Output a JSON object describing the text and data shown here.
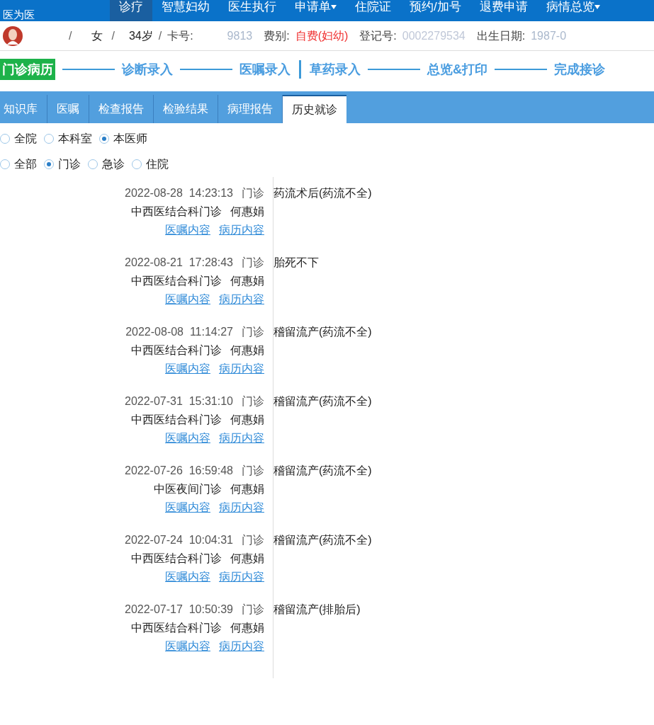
{
  "top_nav": {
    "logo_text": "医为医",
    "items": [
      {
        "label": "诊疗",
        "selected": true,
        "dropdown": false
      },
      {
        "label": "智慧妇幼",
        "selected": false,
        "dropdown": false
      },
      {
        "label": "医生执行",
        "selected": false,
        "dropdown": false
      },
      {
        "label": "申请单",
        "selected": false,
        "dropdown": true
      },
      {
        "label": "住院证",
        "selected": false,
        "dropdown": false
      },
      {
        "label": "预约/加号",
        "selected": false,
        "dropdown": false
      },
      {
        "label": "退费申请",
        "selected": false,
        "dropdown": false
      },
      {
        "label": "病情总览",
        "selected": false,
        "dropdown": true
      }
    ]
  },
  "patient": {
    "slash_1": "/",
    "sex": "女",
    "slash_2": "/",
    "age": "34岁",
    "slash_3": "/",
    "card_label": "卡号:",
    "card_value": "9813",
    "fee_label": "费别:",
    "fee_value": "自费(妇幼)",
    "reg_label": "登记号:",
    "reg_value": "0002279534",
    "birth_label": "出生日期:",
    "birth_value": "1987-0"
  },
  "workflow": {
    "badge": "门诊病历",
    "steps": [
      {
        "label": "诊断录入",
        "kind": "line"
      },
      {
        "label": "医嘱录入",
        "kind": "line"
      },
      {
        "label": "草药录入",
        "kind": "bar"
      },
      {
        "label": "总览&打印",
        "kind": "line"
      },
      {
        "label": "完成接诊",
        "kind": "line"
      }
    ]
  },
  "tabs": [
    {
      "label": "知识库",
      "selected": false
    },
    {
      "label": "医嘱",
      "selected": false
    },
    {
      "label": "检查报告",
      "selected": false
    },
    {
      "label": "检验结果",
      "selected": false
    },
    {
      "label": "病理报告",
      "selected": false
    },
    {
      "label": "历史就诊",
      "selected": true
    }
  ],
  "scope_filter": [
    {
      "label": "全院",
      "selected": false
    },
    {
      "label": "本科室",
      "selected": false
    },
    {
      "label": "本医师",
      "selected": true
    }
  ],
  "type_filter": [
    {
      "label": "全部",
      "selected": false
    },
    {
      "label": "门诊",
      "selected": true
    },
    {
      "label": "急诊",
      "selected": false
    },
    {
      "label": "住院",
      "selected": false
    }
  ],
  "visits": [
    {
      "datetime": "2022-08-28  14:23:13",
      "type": "门诊",
      "department": "中西医结合科门诊",
      "doctor": "何惠娟",
      "links": [
        "医嘱内容",
        "病历内容"
      ],
      "diagnosis": "药流术后(药流不全)"
    },
    {
      "datetime": "2022-08-21  17:28:43",
      "type": "门诊",
      "department": "中西医结合科门诊",
      "doctor": "何惠娟",
      "links": [
        "医嘱内容",
        "病历内容"
      ],
      "diagnosis": "胎死不下"
    },
    {
      "datetime": "2022-08-08  11:14:27",
      "type": "门诊",
      "department": "中西医结合科门诊",
      "doctor": "何惠娟",
      "links": [
        "医嘱内容",
        "病历内容"
      ],
      "diagnosis": "稽留流产(药流不全)"
    },
    {
      "datetime": "2022-07-31  15:31:10",
      "type": "门诊",
      "department": "中西医结合科门诊",
      "doctor": "何惠娟",
      "links": [
        "医嘱内容",
        "病历内容"
      ],
      "diagnosis": "稽留流产(药流不全)"
    },
    {
      "datetime": "2022-07-26  16:59:48",
      "type": "门诊",
      "department": "中医夜间门诊",
      "doctor": "何惠娟",
      "links": [
        "医嘱内容",
        "病历内容"
      ],
      "diagnosis": "稽留流产(药流不全)"
    },
    {
      "datetime": "2022-07-24  10:04:31",
      "type": "门诊",
      "department": "中西医结合科门诊",
      "doctor": "何惠娟",
      "links": [
        "医嘱内容",
        "病历内容"
      ],
      "diagnosis": "稽留流产(药流不全)"
    },
    {
      "datetime": "2022-07-17  10:50:39",
      "type": "门诊",
      "department": "中西医结合科门诊",
      "doctor": "何惠娟",
      "links": [
        "医嘱内容",
        "病历内容"
      ],
      "diagnosis": "稽留流产(排胎后)"
    }
  ]
}
